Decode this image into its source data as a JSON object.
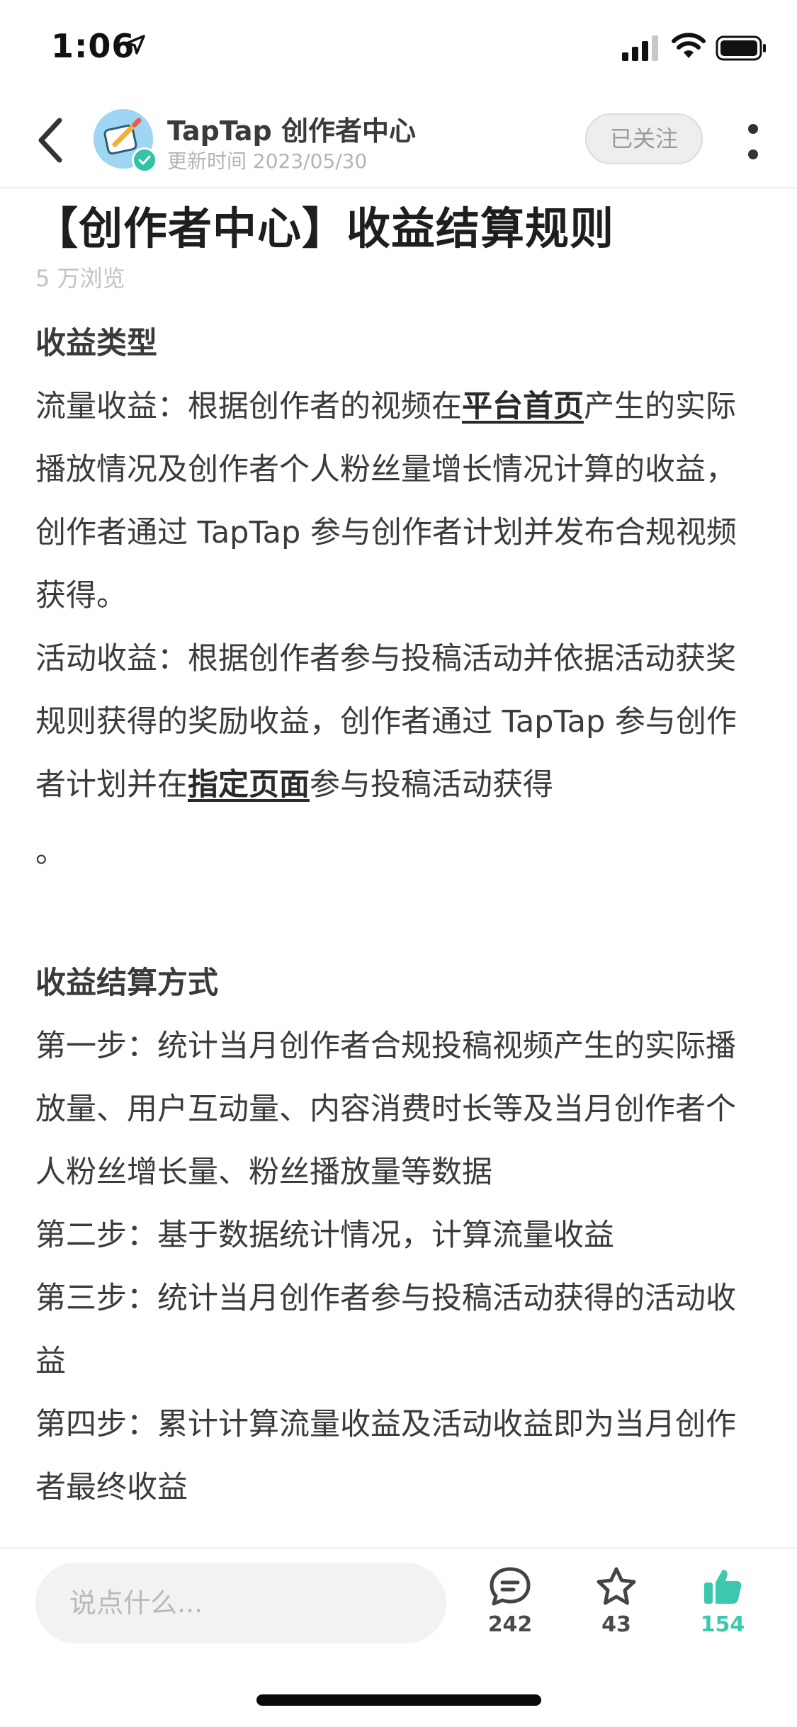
{
  "status_bar": {
    "time": "1:06",
    "icons": [
      "location-arrow-icon",
      "signal-icon",
      "wifi-icon",
      "battery-icon"
    ]
  },
  "header": {
    "author_name": "TapTap 创作者中心",
    "update_time": "更新时间 2023/05/30",
    "follow_label": "已关注",
    "icons": [
      "back-chevron-icon",
      "more-vertical-icon",
      "verified-badge-icon"
    ]
  },
  "article": {
    "title": "【创作者中心】收益结算规则",
    "views": "5 万浏览",
    "section1_heading": "收益类型",
    "p1_pre": "流量收益：根据创作者的视频在",
    "p1_link": "平台首页",
    "p1_post": "产生的实际播放情况及创作者个人粉丝量增长情况计算的收益，创作者通过 TapTap 参与创作者计划并发布合规视频获得。",
    "p2_pre": "活动收益：根据创作者参与投稿活动并依据活动获奖规则获得的奖励收益，创作者通过 TapTap 参与创作者计划并在",
    "p2_link": "指定页面",
    "p2_post": "参与投稿活动获得",
    "p2_end": "。",
    "section2_heading": "收益结算方式",
    "step1": "第一步：统计当月创作者合规投稿视频产生的实际播放量、用户互动量、内容消费时长等及当月创作者个人粉丝增长量、粉丝播放量等数据",
    "step2": "第二步：基于数据统计情况，计算流量收益",
    "step3": "第三步：统计当月创作者参与投稿活动获得的活动收益",
    "step4": "第四步：累计计算流量收益及活动收益即为当月创作者最终收益"
  },
  "bottom_bar": {
    "comment_placeholder": "说点什么...",
    "comment_count": "242",
    "favorite_count": "43",
    "like_count": "154",
    "like_color": "#3cc8b0"
  }
}
